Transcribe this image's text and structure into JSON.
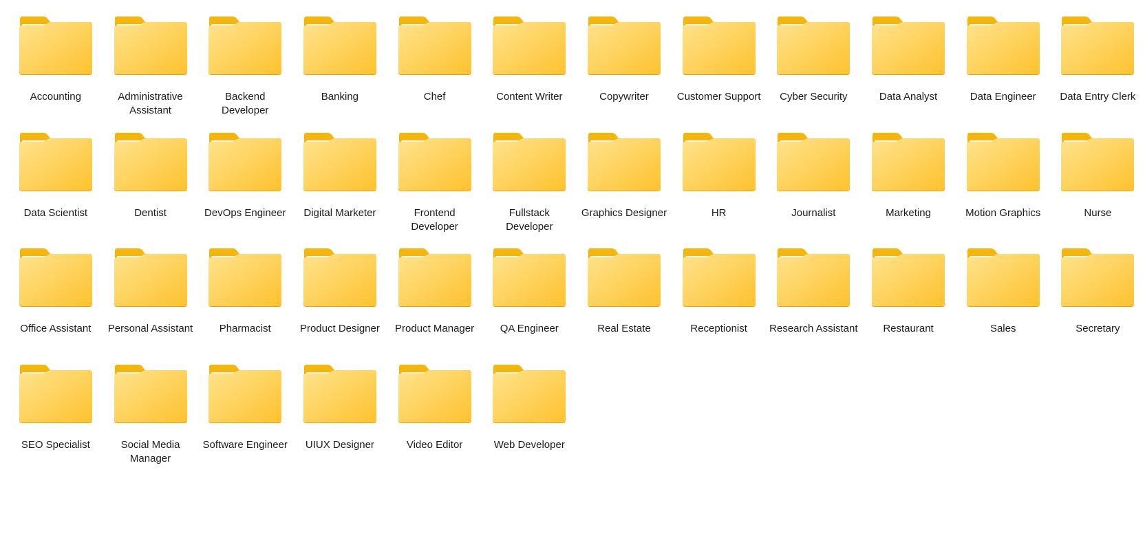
{
  "folder_view": {
    "icon": "folder-icon",
    "colors": {
      "folder_back": "#f5b60c",
      "folder_front_light": "#ffe38d",
      "folder_front_dark": "#fec22e",
      "paper": "#f4f4f4",
      "label_text": "#1b1b1b"
    },
    "items": [
      {
        "label": "Accounting",
        "name": "folder-accounting"
      },
      {
        "label": "Administrative Assistant",
        "name": "folder-administrative-assistant"
      },
      {
        "label": "Backend Developer",
        "name": "folder-backend-developer"
      },
      {
        "label": "Banking",
        "name": "folder-banking"
      },
      {
        "label": "Chef",
        "name": "folder-chef"
      },
      {
        "label": "Content Writer",
        "name": "folder-content-writer"
      },
      {
        "label": "Copywriter",
        "name": "folder-copywriter"
      },
      {
        "label": "Customer Support",
        "name": "folder-customer-support"
      },
      {
        "label": "Cyber Security",
        "name": "folder-cyber-security"
      },
      {
        "label": "Data Analyst",
        "name": "folder-data-analyst"
      },
      {
        "label": "Data Engineer",
        "name": "folder-data-engineer"
      },
      {
        "label": "Data Entry Clerk",
        "name": "folder-data-entry-clerk"
      },
      {
        "label": "Data Scientist",
        "name": "folder-data-scientist"
      },
      {
        "label": "Dentist",
        "name": "folder-dentist"
      },
      {
        "label": "DevOps Engineer",
        "name": "folder-devops-engineer"
      },
      {
        "label": "Digital Marketer",
        "name": "folder-digital-marketer"
      },
      {
        "label": "Frontend Developer",
        "name": "folder-frontend-developer"
      },
      {
        "label": "Fullstack Developer",
        "name": "folder-fullstack-developer"
      },
      {
        "label": "Graphics Designer",
        "name": "folder-graphics-designer"
      },
      {
        "label": "HR",
        "name": "folder-hr"
      },
      {
        "label": "Journalist",
        "name": "folder-journalist"
      },
      {
        "label": "Marketing",
        "name": "folder-marketing"
      },
      {
        "label": "Motion Graphics",
        "name": "folder-motion-graphics"
      },
      {
        "label": "Nurse",
        "name": "folder-nurse"
      },
      {
        "label": "Office Assistant",
        "name": "folder-office-assistant"
      },
      {
        "label": "Personal Assistant",
        "name": "folder-personal-assistant"
      },
      {
        "label": "Pharmacist",
        "name": "folder-pharmacist"
      },
      {
        "label": "Product Designer",
        "name": "folder-product-designer"
      },
      {
        "label": "Product Manager",
        "name": "folder-product-manager"
      },
      {
        "label": "QA Engineer",
        "name": "folder-qa-engineer"
      },
      {
        "label": "Real Estate",
        "name": "folder-real-estate"
      },
      {
        "label": "Receptionist",
        "name": "folder-receptionist"
      },
      {
        "label": "Research Assistant",
        "name": "folder-research-assistant"
      },
      {
        "label": "Restaurant",
        "name": "folder-restaurant"
      },
      {
        "label": "Sales",
        "name": "folder-sales"
      },
      {
        "label": "Secretary",
        "name": "folder-secretary"
      },
      {
        "label": "SEO Specialist",
        "name": "folder-seo-specialist"
      },
      {
        "label": "Social Media Manager",
        "name": "folder-social-media-manager"
      },
      {
        "label": "Software Engineer",
        "name": "folder-software-engineer"
      },
      {
        "label": "UIUX Designer",
        "name": "folder-uiux-designer"
      },
      {
        "label": "Video Editor",
        "name": "folder-video-editor"
      },
      {
        "label": "Web Developer",
        "name": "folder-web-developer"
      }
    ]
  }
}
